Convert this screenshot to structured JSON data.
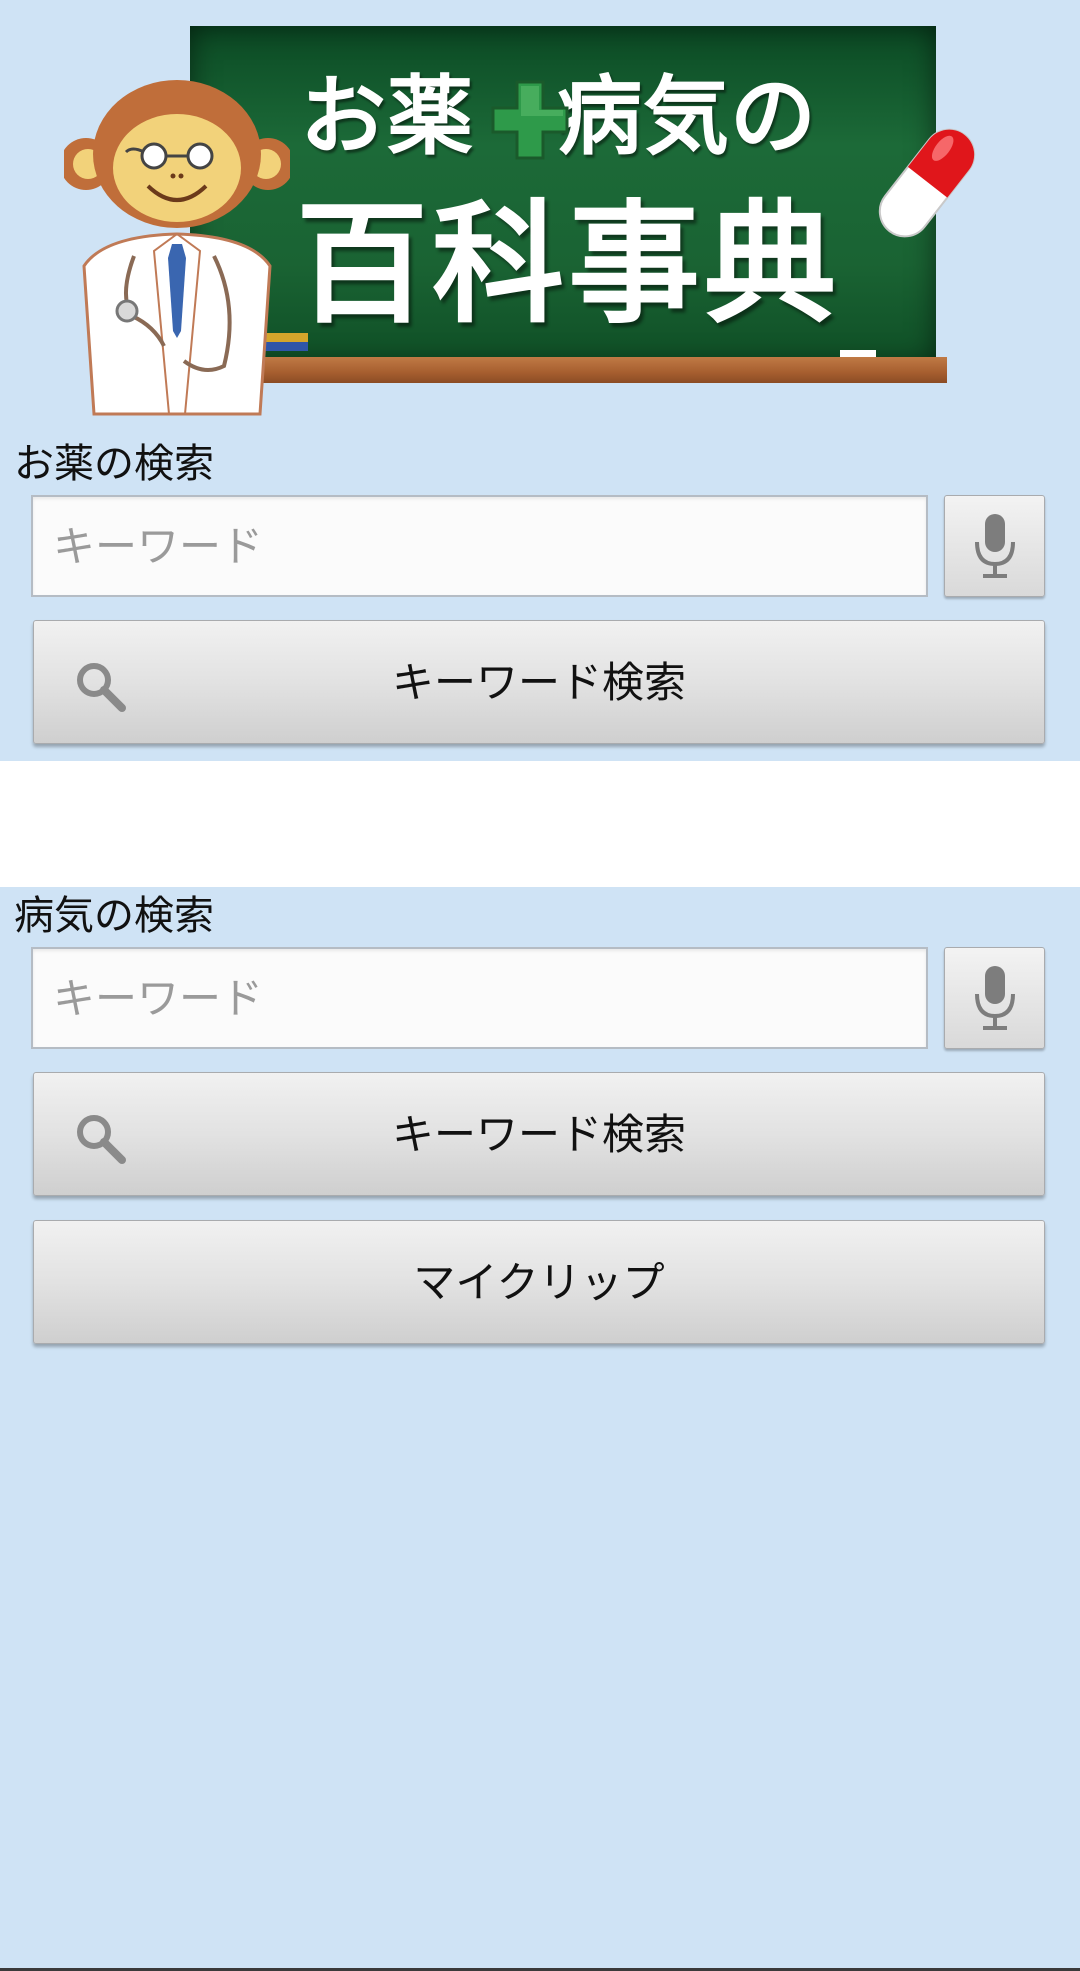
{
  "banner": {
    "title_line1_part1": "お薬",
    "title_line1_part2": "病気の",
    "title_line2": "百科事典",
    "mascot_icon": "monkey-doctor-icon",
    "cross_icon": "green-cross-icon",
    "capsule_icon": "capsule-icon",
    "board_color": "#1c6a38",
    "cross_color": "#2e9a4a",
    "capsule_color": "#e0161b"
  },
  "medicine_search": {
    "title": "お薬の検索",
    "input_placeholder": "キーワード",
    "input_value": "",
    "mic_icon": "microphone-icon",
    "search_button_label": "キーワード検索",
    "search_icon": "magnifier-icon"
  },
  "disease_search": {
    "title": "病気の検索",
    "input_placeholder": "キーワード",
    "input_value": "",
    "mic_icon": "microphone-icon",
    "search_button_label": "キーワード検索",
    "search_icon": "magnifier-icon"
  },
  "myclip": {
    "button_label": "マイクリップ"
  },
  "colors": {
    "background": "#cfe3f5",
    "separator": "#ffffff",
    "button_text": "#111111",
    "placeholder": "#9a9a9a"
  }
}
